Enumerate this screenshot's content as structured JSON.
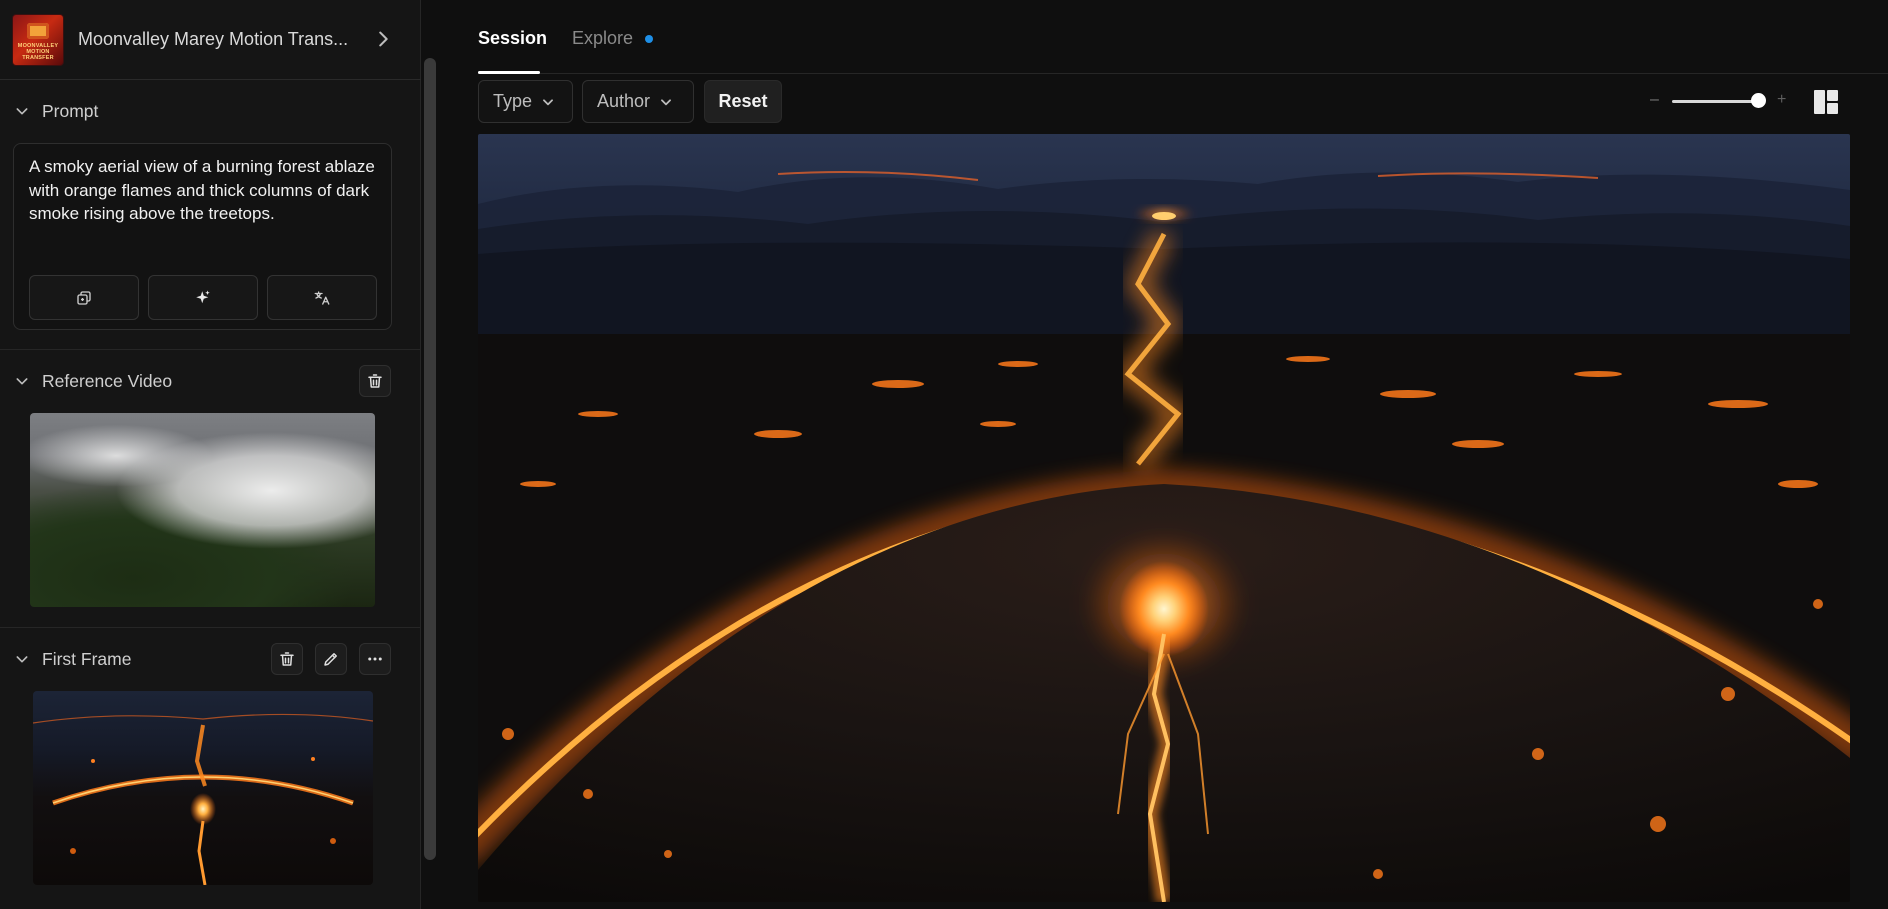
{
  "app": {
    "title": "Moonvalley Marey Motion Trans...",
    "logo_text": "MOONVALLEY MOTION TRANSFER"
  },
  "sections": {
    "prompt": {
      "title": "Prompt",
      "text": "A smoky aerial view of a burning forest ablaze with orange flames and thick columns of dark smoke rising above the treetops."
    },
    "reference_video": {
      "title": "Reference Video"
    },
    "first_frame": {
      "title": "First Frame"
    }
  },
  "tabs": [
    {
      "label": "Session",
      "active": true
    },
    {
      "label": "Explore",
      "active": false,
      "has_notification": true
    }
  ],
  "filters": {
    "type_label": "Type",
    "author_label": "Author",
    "reset_label": "Reset"
  },
  "zoom": {
    "minus": "–",
    "plus": "+",
    "level": 0.85
  },
  "colors": {
    "accent_dot": "#1e8fe6",
    "background": "#0f0f0f",
    "sidebar": "#151515"
  },
  "icons": {
    "header": "chevron-right-icon",
    "section_toggle": "chevron-down-icon",
    "prompt_actions": [
      "copy-icon",
      "sparkle-icon",
      "translate-icon"
    ],
    "delete": "trash-icon",
    "edit": "pencil-icon",
    "more": "more-horizontal-icon",
    "layout": "layout-grid-icon"
  }
}
